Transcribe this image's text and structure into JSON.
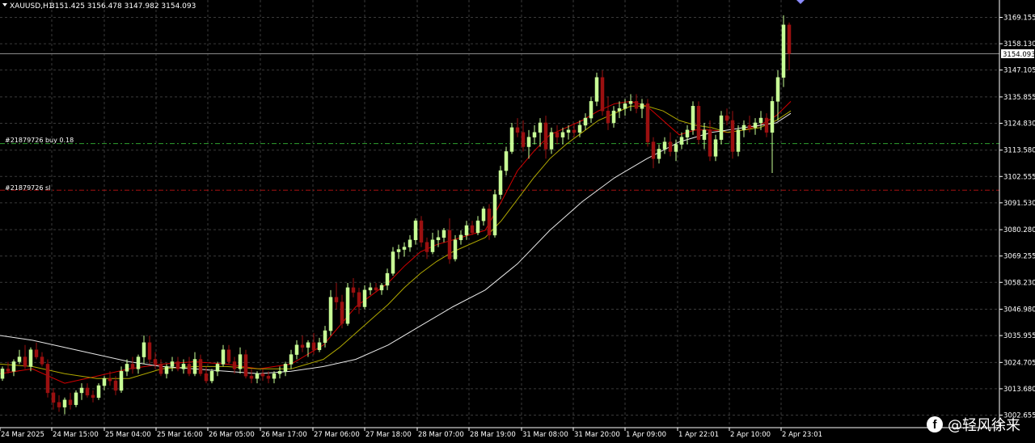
{
  "header": {
    "symbol": "XAUUSD,H1",
    "ohlc": "3151.425 3156.478 3147.982 3154.093"
  },
  "colors": {
    "background": "#000000",
    "grid": "#3a3a3a",
    "bull_candle": "#c8ff96",
    "bear_candle": "#9b1010",
    "ma_fast": "#d40000",
    "ma_mid": "#b0a800",
    "ma_slow": "#e8e8e8",
    "axis_text": "#ffffff",
    "buy_line": "#2fa02f",
    "sl_line": "#a51010"
  },
  "orders": {
    "buy_label": "#21879726 buy 0.18",
    "sl_label": "#21879726 sl"
  },
  "current_price": "3154.093",
  "watermark": {
    "icon": "facebook-icon",
    "text": "@轻风徐来"
  },
  "chart_data": {
    "type": "candlestick",
    "title": "XAUUSD,H1",
    "ylim": [
      3003.0,
      3176.0
    ],
    "y_ticks": [
      "3169.155",
      "3158.130",
      "3147.105",
      "3135.855",
      "3124.830",
      "3113.580",
      "3102.555",
      "3091.530",
      "3080.280",
      "3069.255",
      "3058.230",
      "3046.980",
      "3035.955",
      "3024.705",
      "3013.680",
      "3002.655"
    ],
    "x_ticks": [
      "24 Mar 2025",
      "24 Mar 15:00",
      "25 Mar 04:00",
      "25 Mar 16:00",
      "26 Mar 05:00",
      "26 Mar 17:00",
      "27 Mar 06:00",
      "27 Mar 18:00",
      "28 Mar 07:00",
      "28 Mar 19:00",
      "31 Mar 08:00",
      "31 Mar 20:00",
      "1 Apr 09:00",
      "1 Apr 22:01",
      "2 Apr 10:00",
      "2 Apr 23:01"
    ],
    "grid": true,
    "buy_price": 3116.3,
    "sl_price": 3096.8,
    "series": [
      {
        "name": "MA fast",
        "color": "#d40000",
        "points": [
          [
            0,
            3020
          ],
          [
            40,
            3022
          ],
          [
            80,
            3016
          ],
          [
            120,
            3019
          ],
          [
            160,
            3022
          ],
          [
            200,
            3024
          ],
          [
            240,
            3025
          ],
          [
            280,
            3024
          ],
          [
            320,
            3022
          ],
          [
            360,
            3024
          ],
          [
            400,
            3032
          ],
          [
            420,
            3040
          ],
          [
            440,
            3048
          ],
          [
            460,
            3053
          ],
          [
            480,
            3058
          ],
          [
            500,
            3065
          ],
          [
            520,
            3071
          ],
          [
            540,
            3074
          ],
          [
            560,
            3076
          ],
          [
            600,
            3080
          ],
          [
            620,
            3092
          ],
          [
            640,
            3105
          ],
          [
            660,
            3113
          ],
          [
            680,
            3120
          ],
          [
            700,
            3123
          ],
          [
            720,
            3126
          ],
          [
            740,
            3130
          ],
          [
            760,
            3133
          ],
          [
            780,
            3134
          ],
          [
            800,
            3132
          ],
          [
            820,
            3126
          ],
          [
            840,
            3120
          ],
          [
            860,
            3122
          ],
          [
            880,
            3122
          ],
          [
            900,
            3121
          ],
          [
            920,
            3122
          ],
          [
            940,
            3124
          ],
          [
            960,
            3128
          ],
          [
            978,
            3134
          ]
        ]
      },
      {
        "name": "MA mid",
        "color": "#b0a800",
        "points": [
          [
            0,
            3024
          ],
          [
            40,
            3023
          ],
          [
            80,
            3020
          ],
          [
            120,
            3018
          ],
          [
            160,
            3018
          ],
          [
            200,
            3022
          ],
          [
            240,
            3023
          ],
          [
            280,
            3023
          ],
          [
            320,
            3022
          ],
          [
            360,
            3022
          ],
          [
            400,
            3026
          ],
          [
            420,
            3031
          ],
          [
            440,
            3037
          ],
          [
            460,
            3043
          ],
          [
            480,
            3049
          ],
          [
            500,
            3056
          ],
          [
            520,
            3062
          ],
          [
            540,
            3067
          ],
          [
            560,
            3071
          ],
          [
            600,
            3077
          ],
          [
            620,
            3084
          ],
          [
            640,
            3093
          ],
          [
            660,
            3102
          ],
          [
            680,
            3110
          ],
          [
            700,
            3116
          ],
          [
            720,
            3121
          ],
          [
            740,
            3126
          ],
          [
            760,
            3129
          ],
          [
            780,
            3132
          ],
          [
            800,
            3132
          ],
          [
            820,
            3130
          ],
          [
            840,
            3126
          ],
          [
            860,
            3124
          ],
          [
            880,
            3123
          ],
          [
            900,
            3121
          ],
          [
            920,
            3122
          ],
          [
            940,
            3123
          ],
          [
            960,
            3126
          ],
          [
            978,
            3130
          ]
        ]
      },
      {
        "name": "MA slow",
        "color": "#e8e8e8",
        "points": [
          [
            0,
            3036
          ],
          [
            40,
            3034
          ],
          [
            80,
            3031
          ],
          [
            120,
            3028
          ],
          [
            160,
            3025
          ],
          [
            200,
            3023
          ],
          [
            240,
            3022
          ],
          [
            280,
            3021
          ],
          [
            320,
            3020
          ],
          [
            360,
            3021
          ],
          [
            400,
            3023
          ],
          [
            440,
            3026
          ],
          [
            480,
            3032
          ],
          [
            520,
            3040
          ],
          [
            560,
            3048
          ],
          [
            600,
            3055
          ],
          [
            640,
            3066
          ],
          [
            680,
            3080
          ],
          [
            720,
            3092
          ],
          [
            760,
            3102
          ],
          [
            800,
            3110
          ],
          [
            840,
            3117
          ],
          [
            880,
            3121
          ],
          [
            920,
            3123
          ],
          [
            960,
            3125
          ],
          [
            978,
            3129
          ]
        ]
      }
    ],
    "candles": [
      [
        3,
        3018,
        3023,
        3017,
        3022
      ],
      [
        10,
        3022,
        3025,
        3020,
        3021
      ],
      [
        17,
        3021,
        3026,
        3019,
        3025
      ],
      [
        24,
        3025,
        3030,
        3024,
        3027
      ],
      [
        31,
        3027,
        3032,
        3022,
        3023
      ],
      [
        38,
        3023,
        3031,
        3021,
        3030
      ],
      [
        45,
        3030,
        3033,
        3026,
        3027
      ],
      [
        52,
        3027,
        3029,
        3023,
        3024
      ],
      [
        59,
        3024,
        3026,
        3010,
        3012
      ],
      [
        66,
        3012,
        3014,
        3005,
        3008
      ],
      [
        73,
        3008,
        3011,
        3004,
        3006
      ],
      [
        80,
        3006,
        3010,
        3003,
        3009
      ],
      [
        87,
        3009,
        3012,
        3005,
        3007
      ],
      [
        94,
        3007,
        3013,
        3006,
        3012
      ],
      [
        101,
        3012,
        3016,
        3009,
        3014
      ],
      [
        108,
        3014,
        3016,
        3010,
        3011
      ],
      [
        115,
        3011,
        3013,
        3008,
        3010
      ],
      [
        122,
        3010,
        3016,
        3009,
        3015
      ],
      [
        129,
        3015,
        3019,
        3013,
        3018
      ],
      [
        136,
        3018,
        3021,
        3015,
        3017
      ],
      [
        143,
        3017,
        3019,
        3011,
        3013
      ],
      [
        150,
        3013,
        3023,
        3012,
        3021
      ],
      [
        157,
        3021,
        3026,
        3019,
        3024
      ],
      [
        164,
        3024,
        3027,
        3020,
        3022
      ],
      [
        171,
        3022,
        3028,
        3020,
        3027
      ],
      [
        178,
        3027,
        3036,
        3024,
        3033
      ],
      [
        185,
        3033,
        3036,
        3024,
        3026
      ],
      [
        192,
        3026,
        3029,
        3022,
        3024
      ],
      [
        199,
        3024,
        3026,
        3019,
        3020
      ],
      [
        206,
        3020,
        3024,
        3018,
        3023
      ],
      [
        213,
        3023,
        3027,
        3021,
        3025
      ],
      [
        220,
        3025,
        3027,
        3021,
        3022
      ],
      [
        227,
        3022,
        3026,
        3020,
        3024
      ],
      [
        234,
        3024,
        3027,
        3019,
        3020
      ],
      [
        241,
        3020,
        3029,
        3019,
        3026
      ],
      [
        248,
        3026,
        3028,
        3019,
        3020
      ],
      [
        255,
        3020,
        3023,
        3016,
        3017
      ],
      [
        262,
        3017,
        3022,
        3016,
        3021
      ],
      [
        269,
        3021,
        3025,
        3019,
        3024
      ],
      [
        276,
        3024,
        3032,
        3023,
        3030
      ],
      [
        283,
        3030,
        3032,
        3024,
        3025
      ],
      [
        290,
        3025,
        3027,
        3020,
        3022
      ],
      [
        297,
        3022,
        3031,
        3020,
        3028
      ],
      [
        304,
        3028,
        3030,
        3018,
        3019
      ],
      [
        311,
        3019,
        3022,
        3016,
        3018
      ],
      [
        318,
        3018,
        3021,
        3016,
        3020
      ],
      [
        325,
        3020,
        3022,
        3017,
        3019
      ],
      [
        332,
        3019,
        3021,
        3016,
        3018
      ],
      [
        339,
        3018,
        3021,
        3016,
        3020
      ],
      [
        346,
        3020,
        3023,
        3018,
        3021
      ],
      [
        353,
        3021,
        3025,
        3019,
        3024
      ],
      [
        360,
        3024,
        3030,
        3022,
        3028
      ],
      [
        367,
        3028,
        3034,
        3026,
        3032
      ],
      [
        374,
        3032,
        3036,
        3029,
        3031
      ],
      [
        381,
        3031,
        3034,
        3027,
        3033
      ],
      [
        388,
        3033,
        3037,
        3028,
        3030
      ],
      [
        395,
        3030,
        3035,
        3029,
        3033
      ],
      [
        402,
        3033,
        3040,
        3031,
        3038
      ],
      [
        409,
        3038,
        3055,
        3036,
        3052
      ],
      [
        416,
        3052,
        3058,
        3047,
        3050
      ],
      [
        423,
        3050,
        3053,
        3039,
        3041
      ],
      [
        430,
        3041,
        3058,
        3040,
        3056
      ],
      [
        437,
        3056,
        3060,
        3052,
        3054
      ],
      [
        444,
        3054,
        3056,
        3045,
        3048
      ],
      [
        451,
        3048,
        3057,
        3047,
        3055
      ],
      [
        458,
        3055,
        3058,
        3053,
        3056
      ],
      [
        465,
        3056,
        3058,
        3054,
        3055
      ],
      [
        472,
        3055,
        3058,
        3053,
        3057
      ],
      [
        479,
        3057,
        3064,
        3055,
        3062
      ],
      [
        486,
        3062,
        3073,
        3061,
        3071
      ],
      [
        493,
        3071,
        3074,
        3068,
        3072
      ],
      [
        500,
        3072,
        3075,
        3069,
        3073
      ],
      [
        507,
        3073,
        3078,
        3071,
        3076
      ],
      [
        514,
        3076,
        3085,
        3074,
        3084
      ],
      [
        521,
        3084,
        3086,
        3073,
        3075
      ],
      [
        528,
        3075,
        3077,
        3068,
        3071
      ],
      [
        535,
        3071,
        3079,
        3070,
        3076
      ],
      [
        542,
        3076,
        3080,
        3073,
        3077
      ],
      [
        549,
        3077,
        3081,
        3075,
        3080
      ],
      [
        556,
        3080,
        3085,
        3066,
        3068
      ],
      [
        563,
        3068,
        3078,
        3067,
        3076
      ],
      [
        570,
        3076,
        3080,
        3074,
        3078
      ],
      [
        577,
        3078,
        3084,
        3076,
        3082
      ],
      [
        584,
        3082,
        3084,
        3078,
        3079
      ],
      [
        591,
        3079,
        3086,
        3078,
        3084
      ],
      [
        598,
        3084,
        3090,
        3082,
        3089
      ],
      [
        605,
        3089,
        3091,
        3076,
        3078
      ],
      [
        612,
        3078,
        3097,
        3077,
        3095
      ],
      [
        619,
        3095,
        3107,
        3093,
        3105
      ],
      [
        626,
        3105,
        3115,
        3103,
        3113
      ],
      [
        633,
        3113,
        3125,
        3112,
        3123
      ],
      [
        640,
        3123,
        3127,
        3119,
        3121
      ],
      [
        647,
        3121,
        3126,
        3113,
        3115
      ],
      [
        654,
        3115,
        3122,
        3110,
        3119
      ],
      [
        661,
        3119,
        3124,
        3116,
        3121
      ],
      [
        668,
        3121,
        3127,
        3115,
        3125
      ],
      [
        675,
        3125,
        3128,
        3110,
        3114
      ],
      [
        682,
        3114,
        3123,
        3112,
        3121
      ],
      [
        689,
        3121,
        3124,
        3116,
        3119
      ],
      [
        696,
        3119,
        3123,
        3116,
        3121
      ],
      [
        703,
        3121,
        3124,
        3118,
        3122
      ],
      [
        710,
        3122,
        3125,
        3119,
        3121
      ],
      [
        717,
        3121,
        3126,
        3119,
        3124
      ],
      [
        724,
        3124,
        3129,
        3122,
        3127
      ],
      [
        731,
        3127,
        3136,
        3125,
        3134
      ],
      [
        738,
        3134,
        3146,
        3132,
        3144
      ],
      [
        745,
        3144,
        3147,
        3128,
        3130
      ],
      [
        752,
        3130,
        3136,
        3122,
        3125
      ],
      [
        759,
        3125,
        3132,
        3123,
        3130
      ],
      [
        766,
        3130,
        3134,
        3127,
        3131
      ],
      [
        773,
        3131,
        3135,
        3128,
        3133
      ],
      [
        780,
        3133,
        3137,
        3130,
        3134
      ],
      [
        787,
        3134,
        3137,
        3129,
        3131
      ],
      [
        794,
        3131,
        3135,
        3127,
        3133
      ],
      [
        801,
        3133,
        3135,
        3115,
        3117
      ],
      [
        808,
        3117,
        3119,
        3106,
        3110
      ],
      [
        815,
        3110,
        3116,
        3108,
        3114
      ],
      [
        822,
        3114,
        3119,
        3112,
        3117
      ],
      [
        829,
        3117,
        3121,
        3111,
        3113
      ],
      [
        836,
        3113,
        3118,
        3109,
        3116
      ],
      [
        843,
        3116,
        3121,
        3114,
        3119
      ],
      [
        850,
        3119,
        3124,
        3116,
        3122
      ],
      [
        857,
        3122,
        3134,
        3120,
        3132
      ],
      [
        864,
        3132,
        3134,
        3116,
        3118
      ],
      [
        871,
        3118,
        3125,
        3114,
        3122
      ],
      [
        878,
        3122,
        3126,
        3109,
        3111
      ],
      [
        885,
        3111,
        3120,
        3109,
        3118
      ],
      [
        892,
        3118,
        3130,
        3116,
        3128
      ],
      [
        899,
        3128,
        3131,
        3124,
        3126
      ],
      [
        906,
        3126,
        3130,
        3110,
        3113
      ],
      [
        913,
        3113,
        3124,
        3111,
        3122
      ],
      [
        920,
        3122,
        3126,
        3119,
        3124
      ],
      [
        927,
        3124,
        3128,
        3121,
        3123
      ],
      [
        934,
        3123,
        3127,
        3120,
        3125
      ],
      [
        941,
        3125,
        3130,
        3122,
        3127
      ],
      [
        948,
        3127,
        3129,
        3119,
        3121
      ],
      [
        955,
        3121,
        3136,
        3104,
        3134
      ],
      [
        962,
        3134,
        3147,
        3126,
        3144
      ],
      [
        969,
        3144,
        3170,
        3140,
        3166
      ],
      [
        976,
        3166,
        3167,
        3147,
        3154
      ]
    ]
  }
}
